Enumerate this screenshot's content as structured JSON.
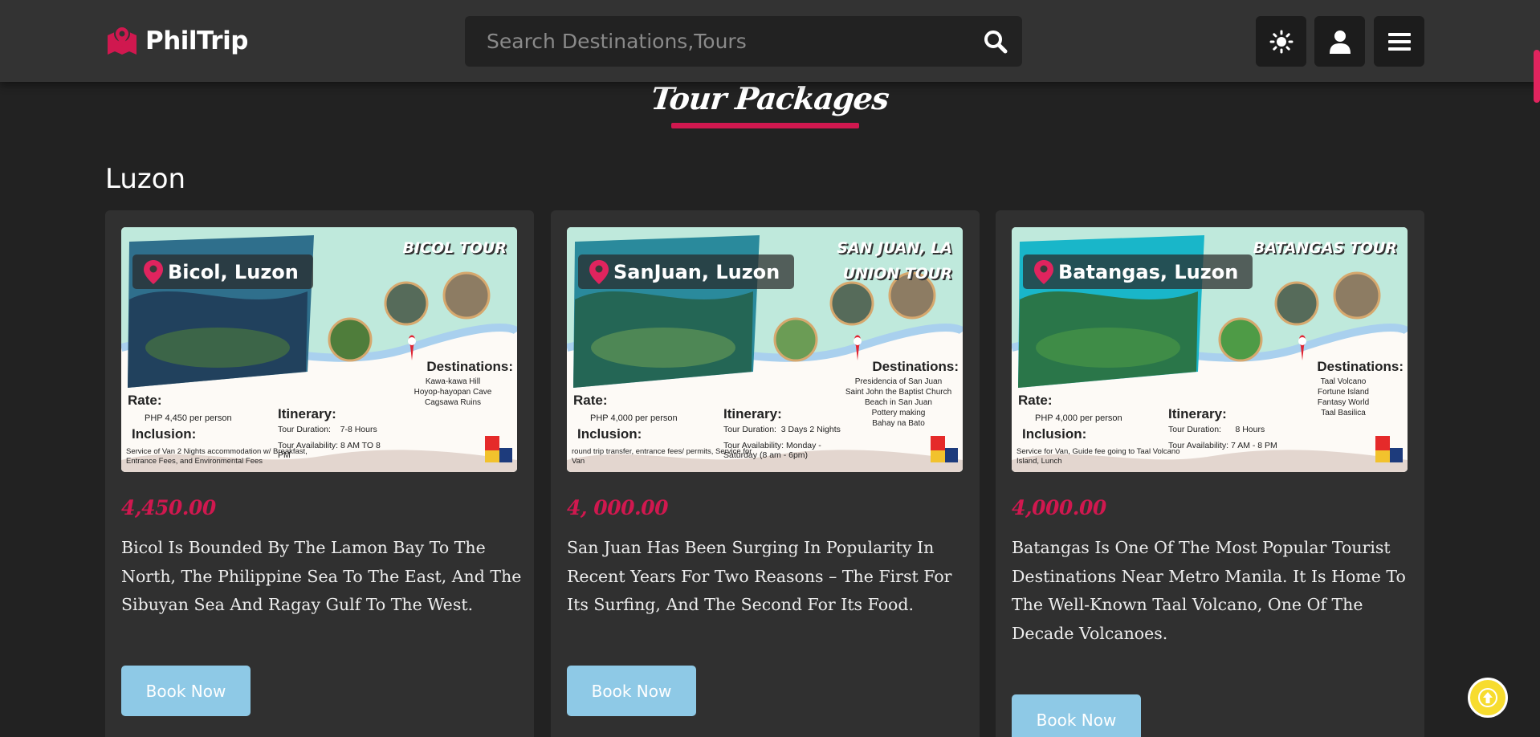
{
  "header": {
    "logo_text": "PhilTrip",
    "search_placeholder": "Search Destinations,Tours",
    "buttons": {
      "theme": "sun-icon",
      "account": "user-icon",
      "menu": "hamburger-icon"
    }
  },
  "page": {
    "section_title": "Tour Packages",
    "region": "Luzon"
  },
  "cards": [
    {
      "location": "Bicol, Luzon",
      "poster_title": "BICOL TOUR",
      "poster_rate_label": "Rate:",
      "poster_rate": "PHP 4,450 per person",
      "poster_inclusion_label": "Inclusion:",
      "poster_inclusion": "Service of Van 2 Nights accommodation w/ Breakfast, Entrance Fees, and Environmental Fees",
      "poster_itinerary_label": "Itinerary:",
      "poster_duration": "Tour Duration:    7-8 Hours",
      "poster_availability": "Tour Availability:   8 AM TO 8 PM",
      "poster_destinations_label": "Destinations:",
      "poster_destinations": [
        "Kawa-kawa Hill",
        "Hoyop-hayopan Cave",
        "Cagsawa Ruins"
      ],
      "price": "4,450.00",
      "description": "Bicol Is Bounded By The Lamon Bay To The North, The Philippine Sea To The East, And The Sibuyan Sea And Ragay Gulf To The West.",
      "button": "Book Now"
    },
    {
      "location": "SanJuan, Luzon",
      "poster_title": "SAN JUAN, LA UNION TOUR",
      "poster_rate_label": "Rate:",
      "poster_rate": "PHP 4,000 per person",
      "poster_inclusion_label": "Inclusion:",
      "poster_inclusion": "round trip transfer, entrance fees/ permits, Service for Van",
      "poster_itinerary_label": "Itinerary:",
      "poster_duration": "Tour Duration:  3 Days 2 Nights",
      "poster_availability": "Tour Availability:  Monday - Saturday (8 am - 6pm)",
      "poster_destinations_label": "Destinations:",
      "poster_destinations": [
        "Presidencia of San Juan",
        "Saint John the Baptist Church",
        "Beach in San Juan",
        "Pottery making",
        "Bahay na Bato"
      ],
      "price": "4, 000.00",
      "description": "San Juan Has Been Surging In Popularity In Recent Years For Two Reasons – The First For Its Surfing, And The Second For Its Food.",
      "button": "Book Now"
    },
    {
      "location": "Batangas, Luzon",
      "poster_title": "BATANGAS TOUR",
      "poster_rate_label": "Rate:",
      "poster_rate": "PHP 4,000 per person",
      "poster_inclusion_label": "Inclusion:",
      "poster_inclusion": "Service for Van, Guide fee going to Taal Volcano Island, Lunch",
      "poster_itinerary_label": "Itinerary:",
      "poster_duration": "Tour Duration:      8 Hours",
      "poster_availability": "Tour Availability:  7 AM - 8 PM",
      "poster_destinations_label": "Destinations:",
      "poster_destinations": [
        "Taal Volcano",
        "Fortune Island",
        "Fantasy World",
        "Taal Basilica"
      ],
      "price": "4,000.00",
      "description": "Batangas Is One Of The Most Popular Tourist Destinations Near Metro Manila. It Is Home To The Well-Known Taal Volcano, One Of The Decade Volcanoes.",
      "button": "Book Now"
    }
  ],
  "colors": {
    "accent": "#d0184f",
    "button": "#8ec9e6",
    "background": "#222222",
    "card": "#303030",
    "header": "#333333"
  },
  "back_to_top": "arrow-up-icon"
}
